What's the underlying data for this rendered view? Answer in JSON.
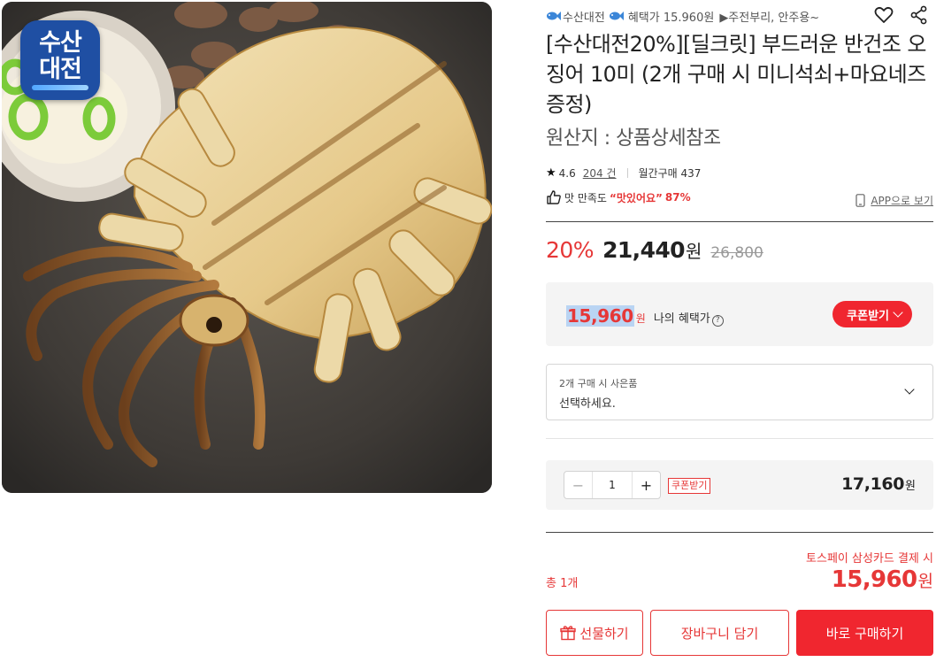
{
  "image": {
    "brand_badge_line1": "수산",
    "brand_badge_line2": "대전"
  },
  "top_line": {
    "brand": "수산대전",
    "benefit": "혜택가 15.960원",
    "tag": "▶주전부리, 안주용~"
  },
  "product": {
    "title": "[수산대전20%][딜크릿] 부드러운 반건조 오징어 10미 (2개 구매 시 미니석쇠+마요네즈 증정)",
    "origin": "원산지 : 상품상세참조"
  },
  "rating": {
    "score": "4.6",
    "reviews": "204 건",
    "monthly": "월간구매 437"
  },
  "taste": {
    "label": "맛 만족도",
    "tag": "“맛있어요”",
    "percent": "87%"
  },
  "app_link": "APP으로 보기",
  "price": {
    "discount": "20%",
    "sale": "21,440",
    "unit": "원",
    "original": "26,800"
  },
  "benefit": {
    "price": "15,960",
    "unit": "원",
    "label": "나의 혜택가",
    "help": "?",
    "coupon_button": "쿠폰받기"
  },
  "gift_option": {
    "label": "2개 구매 시 사은품",
    "placeholder": "선택하세요."
  },
  "quantity": {
    "minus": "−",
    "value": "1",
    "plus": "+",
    "coupon_tag": "쿠폰받기",
    "line_total": "17,160",
    "unit": "원"
  },
  "summary": {
    "toss_note": "토스페이 삼성카드 결제 시",
    "count": "총 1개",
    "total": "15,960",
    "unit": "원"
  },
  "buttons": {
    "gift": "선물하기",
    "cart": "장바구니 담기",
    "buy": "바로 구매하기"
  },
  "colors": {
    "accent": "#e63737",
    "button_red": "#f0262f",
    "badge_blue": "#1f4fa3"
  }
}
